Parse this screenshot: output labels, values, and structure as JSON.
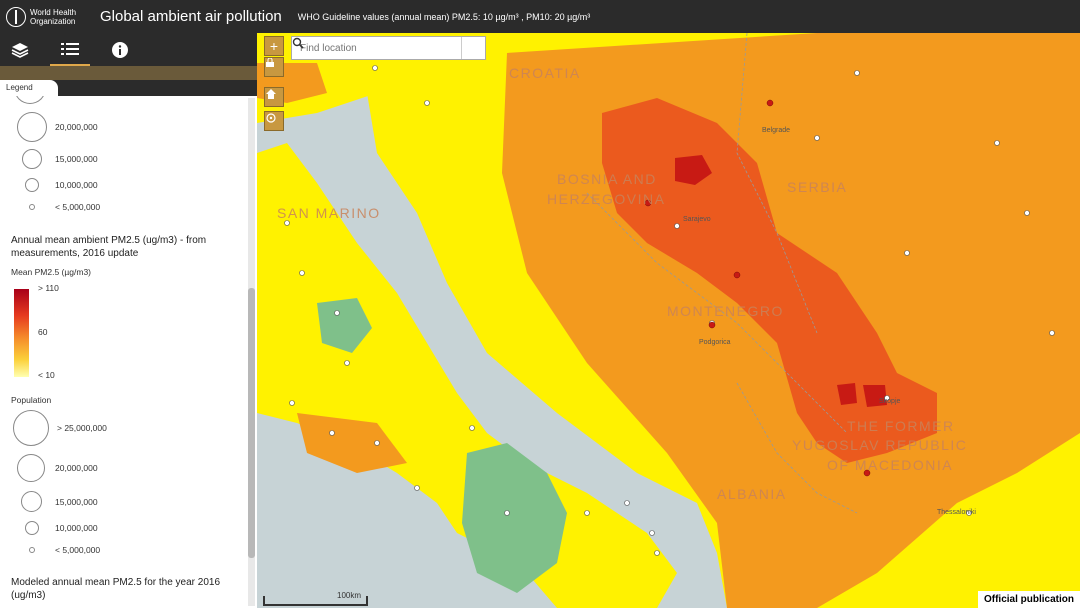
{
  "header": {
    "org_name": "World Health Organization",
    "title": "Global ambient air pollution",
    "guideline": "WHO Guideline values (annual mean)  PM2.5: 10 µg/m³ ,  PM10: 20 µg/m³"
  },
  "toolbar": {
    "layers_icon": "layers-icon",
    "legend_icon": "list-icon",
    "info_icon": "info-icon"
  },
  "legend": {
    "tab_label": "Legend",
    "population_top": [
      {
        "label": "20,000,000"
      },
      {
        "label": "15,000,000"
      },
      {
        "label": "10,000,000"
      },
      {
        "label": "< 5,000,000"
      }
    ],
    "measured_title": "Annual mean ambient PM2.5 (ug/m3) - from measurements, 2016 update",
    "mean_label": "Mean PM2.5 (µg/m3)",
    "ramp_max": "> 110",
    "ramp_mid": "60",
    "ramp_min": "< 10",
    "population_title": "Population",
    "population": [
      {
        "label": "> 25,000,000"
      },
      {
        "label": "20,000,000"
      },
      {
        "label": "15,000,000"
      },
      {
        "label": "10,000,000"
      },
      {
        "label": "< 5,000,000"
      }
    ],
    "modeled_title": "Modeled annual mean PM2.5 for the year 2016 (ug/m3)"
  },
  "map": {
    "search_placeholder": "Find location",
    "zoom_in": "+",
    "labels": {
      "croatia": "CROATIA",
      "bosnia1": "BOSNIA AND",
      "bosnia2": "HERZEGOVINA",
      "serbia": "SERBIA",
      "montenegro": "MONTENEGRO",
      "macedonia1": "THE FORMER",
      "macedonia2": "YUGOSLAV REPUBLIC",
      "macedonia3": "OF MACEDONIA",
      "albania": "ALBANIA",
      "sanmarino": "SAN MARINO"
    },
    "cities": {
      "sarajevo": "Sarajevo",
      "belgrade": "Belgrade",
      "podgorica": "Podgorica",
      "skopje": "Skopje",
      "thessaloniki": "Thessaloniki"
    },
    "scale": "100km"
  },
  "footer": {
    "official": "Official publication"
  },
  "colors": {
    "yellow": "#fff200",
    "orange": "#f39a1e",
    "red_orange": "#eb5a1e",
    "red": "#c81a14",
    "green": "#7fc08a",
    "sea": "#c7d3d6"
  }
}
